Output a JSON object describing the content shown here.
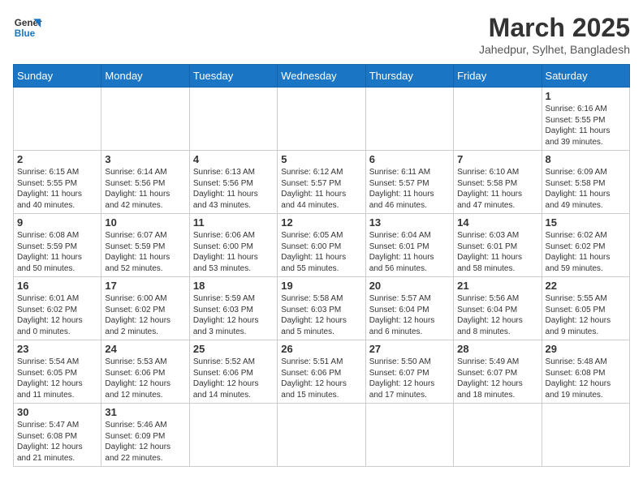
{
  "header": {
    "logo_general": "General",
    "logo_blue": "Blue",
    "title": "March 2025",
    "location": "Jahedpur, Sylhet, Bangladesh"
  },
  "weekdays": [
    "Sunday",
    "Monday",
    "Tuesday",
    "Wednesday",
    "Thursday",
    "Friday",
    "Saturday"
  ],
  "weeks": [
    [
      {
        "day": "",
        "content": ""
      },
      {
        "day": "",
        "content": ""
      },
      {
        "day": "",
        "content": ""
      },
      {
        "day": "",
        "content": ""
      },
      {
        "day": "",
        "content": ""
      },
      {
        "day": "",
        "content": ""
      },
      {
        "day": "1",
        "content": "Sunrise: 6:16 AM\nSunset: 5:55 PM\nDaylight: 11 hours\nand 39 minutes."
      }
    ],
    [
      {
        "day": "2",
        "content": "Sunrise: 6:15 AM\nSunset: 5:55 PM\nDaylight: 11 hours\nand 40 minutes."
      },
      {
        "day": "3",
        "content": "Sunrise: 6:14 AM\nSunset: 5:56 PM\nDaylight: 11 hours\nand 42 minutes."
      },
      {
        "day": "4",
        "content": "Sunrise: 6:13 AM\nSunset: 5:56 PM\nDaylight: 11 hours\nand 43 minutes."
      },
      {
        "day": "5",
        "content": "Sunrise: 6:12 AM\nSunset: 5:57 PM\nDaylight: 11 hours\nand 44 minutes."
      },
      {
        "day": "6",
        "content": "Sunrise: 6:11 AM\nSunset: 5:57 PM\nDaylight: 11 hours\nand 46 minutes."
      },
      {
        "day": "7",
        "content": "Sunrise: 6:10 AM\nSunset: 5:58 PM\nDaylight: 11 hours\nand 47 minutes."
      },
      {
        "day": "8",
        "content": "Sunrise: 6:09 AM\nSunset: 5:58 PM\nDaylight: 11 hours\nand 49 minutes."
      }
    ],
    [
      {
        "day": "9",
        "content": "Sunrise: 6:08 AM\nSunset: 5:59 PM\nDaylight: 11 hours\nand 50 minutes."
      },
      {
        "day": "10",
        "content": "Sunrise: 6:07 AM\nSunset: 5:59 PM\nDaylight: 11 hours\nand 52 minutes."
      },
      {
        "day": "11",
        "content": "Sunrise: 6:06 AM\nSunset: 6:00 PM\nDaylight: 11 hours\nand 53 minutes."
      },
      {
        "day": "12",
        "content": "Sunrise: 6:05 AM\nSunset: 6:00 PM\nDaylight: 11 hours\nand 55 minutes."
      },
      {
        "day": "13",
        "content": "Sunrise: 6:04 AM\nSunset: 6:01 PM\nDaylight: 11 hours\nand 56 minutes."
      },
      {
        "day": "14",
        "content": "Sunrise: 6:03 AM\nSunset: 6:01 PM\nDaylight: 11 hours\nand 58 minutes."
      },
      {
        "day": "15",
        "content": "Sunrise: 6:02 AM\nSunset: 6:02 PM\nDaylight: 11 hours\nand 59 minutes."
      }
    ],
    [
      {
        "day": "16",
        "content": "Sunrise: 6:01 AM\nSunset: 6:02 PM\nDaylight: 12 hours\nand 0 minutes."
      },
      {
        "day": "17",
        "content": "Sunrise: 6:00 AM\nSunset: 6:02 PM\nDaylight: 12 hours\nand 2 minutes."
      },
      {
        "day": "18",
        "content": "Sunrise: 5:59 AM\nSunset: 6:03 PM\nDaylight: 12 hours\nand 3 minutes."
      },
      {
        "day": "19",
        "content": "Sunrise: 5:58 AM\nSunset: 6:03 PM\nDaylight: 12 hours\nand 5 minutes."
      },
      {
        "day": "20",
        "content": "Sunrise: 5:57 AM\nSunset: 6:04 PM\nDaylight: 12 hours\nand 6 minutes."
      },
      {
        "day": "21",
        "content": "Sunrise: 5:56 AM\nSunset: 6:04 PM\nDaylight: 12 hours\nand 8 minutes."
      },
      {
        "day": "22",
        "content": "Sunrise: 5:55 AM\nSunset: 6:05 PM\nDaylight: 12 hours\nand 9 minutes."
      }
    ],
    [
      {
        "day": "23",
        "content": "Sunrise: 5:54 AM\nSunset: 6:05 PM\nDaylight: 12 hours\nand 11 minutes."
      },
      {
        "day": "24",
        "content": "Sunrise: 5:53 AM\nSunset: 6:06 PM\nDaylight: 12 hours\nand 12 minutes."
      },
      {
        "day": "25",
        "content": "Sunrise: 5:52 AM\nSunset: 6:06 PM\nDaylight: 12 hours\nand 14 minutes."
      },
      {
        "day": "26",
        "content": "Sunrise: 5:51 AM\nSunset: 6:06 PM\nDaylight: 12 hours\nand 15 minutes."
      },
      {
        "day": "27",
        "content": "Sunrise: 5:50 AM\nSunset: 6:07 PM\nDaylight: 12 hours\nand 17 minutes."
      },
      {
        "day": "28",
        "content": "Sunrise: 5:49 AM\nSunset: 6:07 PM\nDaylight: 12 hours\nand 18 minutes."
      },
      {
        "day": "29",
        "content": "Sunrise: 5:48 AM\nSunset: 6:08 PM\nDaylight: 12 hours\nand 19 minutes."
      }
    ],
    [
      {
        "day": "30",
        "content": "Sunrise: 5:47 AM\nSunset: 6:08 PM\nDaylight: 12 hours\nand 21 minutes."
      },
      {
        "day": "31",
        "content": "Sunrise: 5:46 AM\nSunset: 6:09 PM\nDaylight: 12 hours\nand 22 minutes."
      },
      {
        "day": "",
        "content": ""
      },
      {
        "day": "",
        "content": ""
      },
      {
        "day": "",
        "content": ""
      },
      {
        "day": "",
        "content": ""
      },
      {
        "day": "",
        "content": ""
      }
    ]
  ]
}
